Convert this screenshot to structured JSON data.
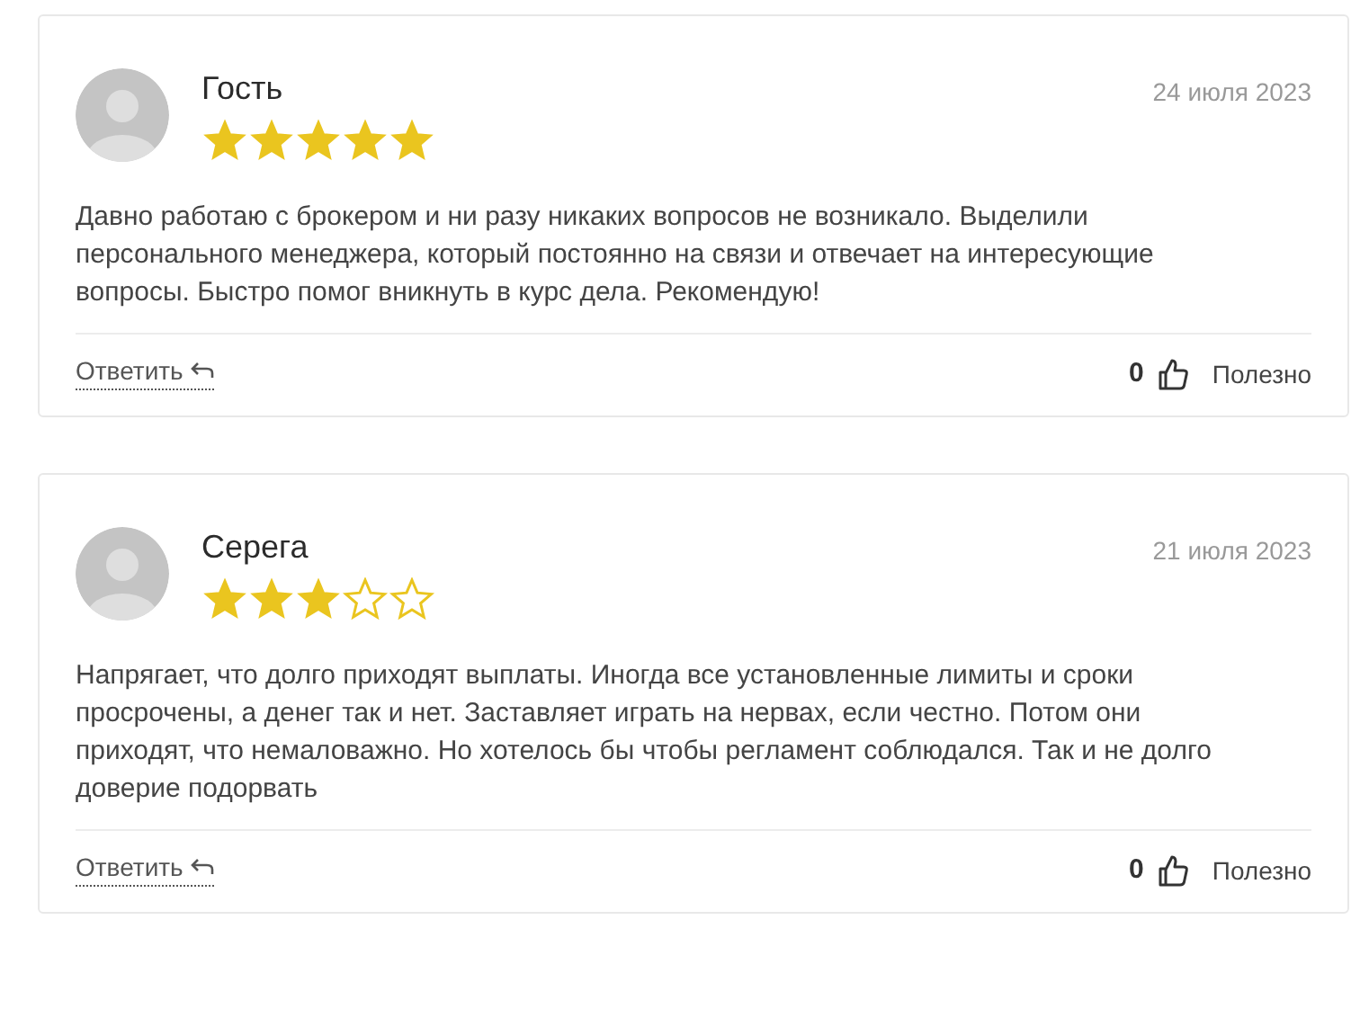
{
  "reviews": [
    {
      "author": "Гость",
      "date": "24 июля 2023",
      "stars": 5,
      "text": "Давно работаю с брокером и ни разу никаких вопросов не возникало. Выделили персонального менеджера, который постоянно на связи и отвечает на интересующие вопросы. Быстро помог вникнуть в курс дела. Рекомендую!",
      "reply": "Ответить",
      "likes": "0",
      "helpful": "Полезно"
    },
    {
      "author": "Серега",
      "date": "21 июля 2023",
      "stars": 3,
      "text": "Напрягает, что долго приходят выплаты. Иногда все установленные лимиты и сроки просрочены, а денег так и нет. Заставляет играть на нервах, если честно. Потом они приходят, что немаловажно. Но хотелось бы чтобы регламент соблюдался. Так и не долго доверие подорвать",
      "reply": "Ответить",
      "likes": "0",
      "helpful": "Полезно"
    }
  ]
}
